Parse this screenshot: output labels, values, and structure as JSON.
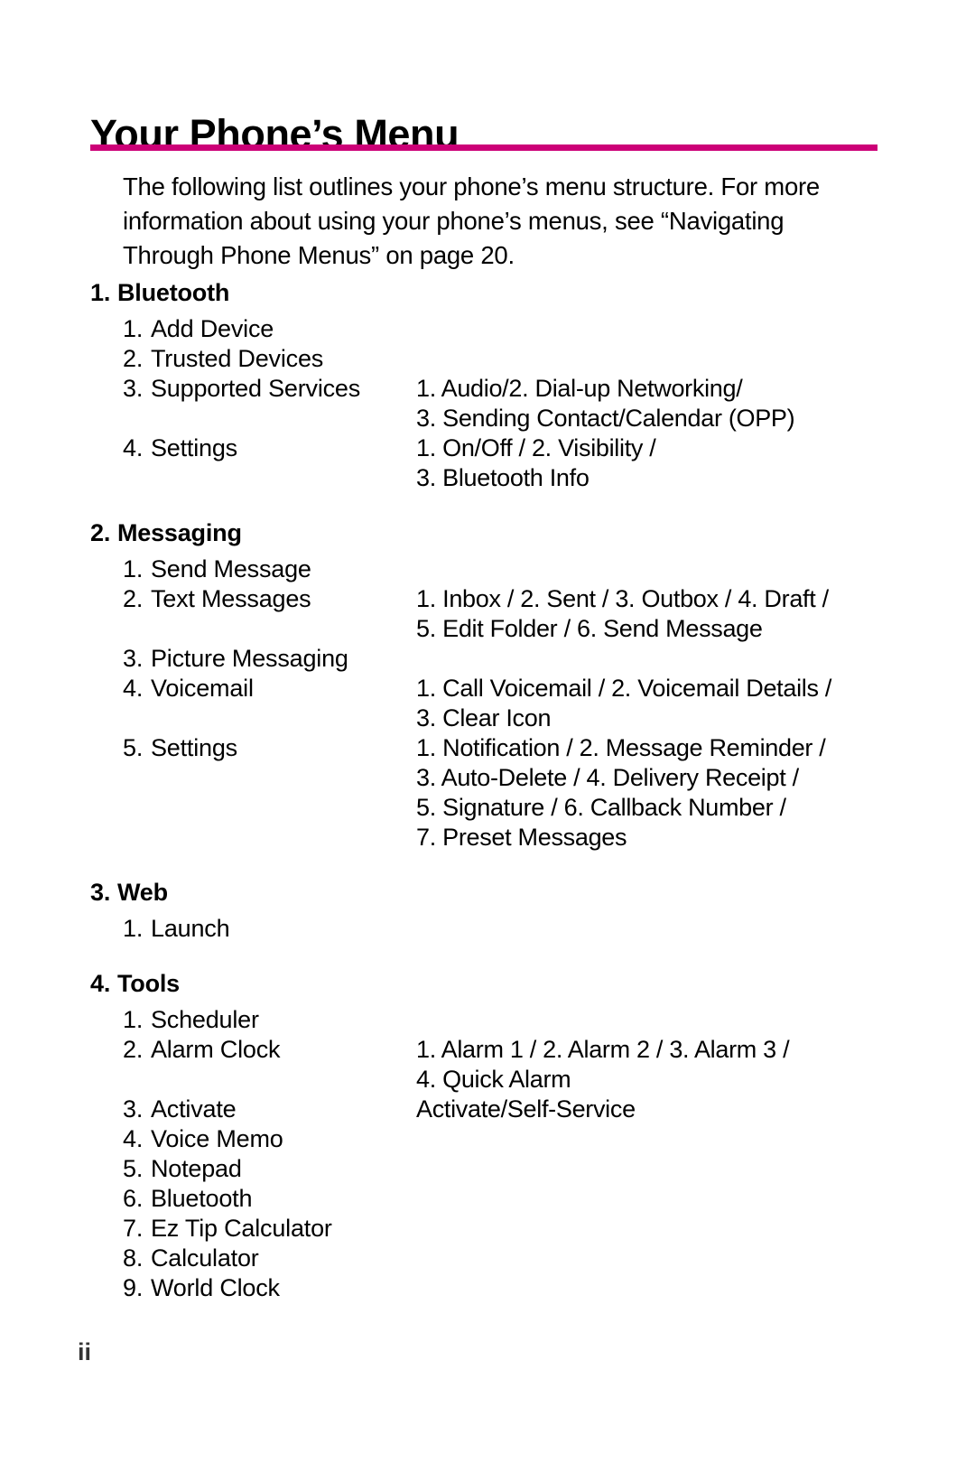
{
  "document": {
    "title": "Your Phone’s Menu",
    "rule_color": "#cc0077",
    "intro": "The following list outlines your phone’s menu structure. For more information about using your phone’s menus, see “Navigating Through Phone Menus” on page 20.",
    "folio": "ii"
  },
  "menu": {
    "sections": [
      {
        "num": "1.",
        "label": "Bluetooth",
        "items": [
          {
            "num": "1.",
            "label": "Add Device",
            "detail": []
          },
          {
            "num": "2.",
            "label": "Trusted Devices",
            "detail": []
          },
          {
            "num": "3.",
            "label": "Supported Services",
            "detail": [
              "1. Audio/2. Dial-up Networking/",
              "3. Sending Contact/Calendar (OPP)"
            ]
          },
          {
            "num": "4.",
            "label": "Settings",
            "detail": [
              "1. On/Off / 2. Visibility /",
              "3. Bluetooth Info"
            ]
          }
        ]
      },
      {
        "num": "2.",
        "label": "Messaging",
        "items": [
          {
            "num": "1.",
            "label": "Send Message",
            "detail": []
          },
          {
            "num": "2.",
            "label": "Text Messages",
            "detail": [
              "1. Inbox / 2. Sent / 3. Outbox / 4. Draft /",
              "5. Edit Folder / 6. Send Message"
            ]
          },
          {
            "num": "3.",
            "label": "Picture Messaging",
            "detail": []
          },
          {
            "num": "4.",
            "label": "Voicemail",
            "detail": [
              "1. Call Voicemail / 2. Voicemail Details /",
              "3. Clear Icon"
            ]
          },
          {
            "num": "5.",
            "label": "Settings",
            "detail": [
              "1. Notification / 2. Message Reminder /",
              "3. Auto-Delete / 4. Delivery Receipt /",
              "5. Signature / 6. Callback Number /",
              "7. Preset Messages"
            ]
          }
        ]
      },
      {
        "num": "3.",
        "label": "Web",
        "items": [
          {
            "num": "1.",
            "label": "Launch",
            "detail": []
          }
        ]
      },
      {
        "num": "4.",
        "label": "Tools",
        "items": [
          {
            "num": "1.",
            "label": "Scheduler",
            "detail": []
          },
          {
            "num": "2.",
            "label": "Alarm Clock",
            "detail": [
              "1. Alarm 1 / 2. Alarm 2 / 3. Alarm 3 /",
              "4. Quick Alarm"
            ]
          },
          {
            "num": "3.",
            "label": "Activate",
            "detail": [
              "Activate/Self-Service"
            ]
          },
          {
            "num": "4.",
            "label": "Voice Memo",
            "detail": []
          },
          {
            "num": "5.",
            "label": "Notepad",
            "detail": []
          },
          {
            "num": "6.",
            "label": "Bluetooth",
            "detail": []
          },
          {
            "num": "7.",
            "label": "Ez Tip Calculator",
            "detail": []
          },
          {
            "num": "8.",
            "label": "Calculator",
            "detail": []
          },
          {
            "num": "9.",
            "label": "World Clock",
            "detail": []
          }
        ]
      }
    ]
  }
}
